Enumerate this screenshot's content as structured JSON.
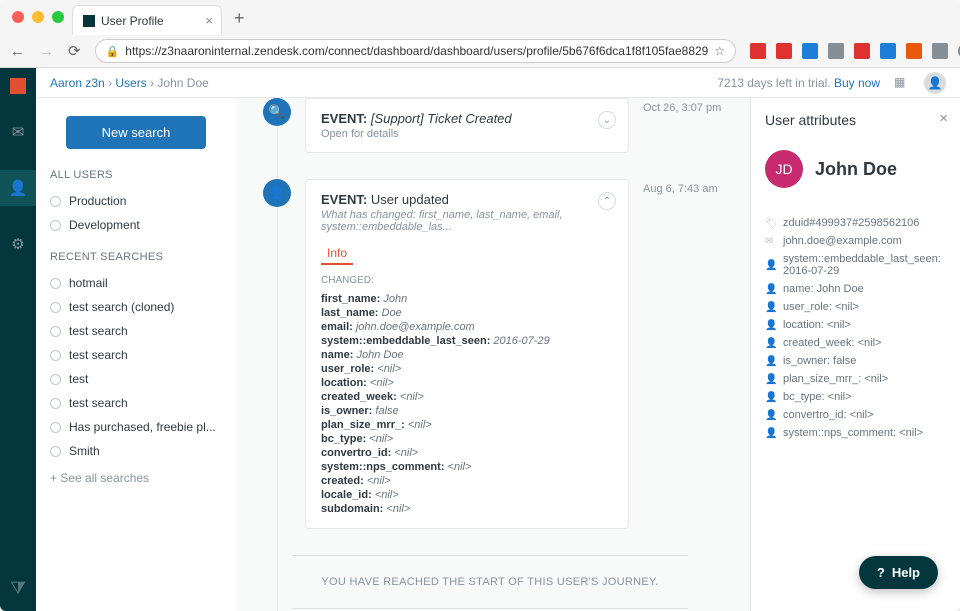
{
  "browser": {
    "tab_title": "User Profile",
    "url": "https://z3naaroninternal.zendesk.com/connect/dashboard/dashboard/users/profile/5b676f6dca1f8f105fae8829"
  },
  "breadcrumb": {
    "root": "Aaron z3n",
    "mid": "Users",
    "current": "John Doe"
  },
  "trial": {
    "text": "7213 days left in trial.",
    "link": "Buy now"
  },
  "sidebar": {
    "new_search": "New search",
    "all_users_heading": "ALL USERS",
    "all_users": [
      "Production",
      "Development"
    ],
    "recent_heading": "RECENT SEARCHES",
    "recent": [
      "hotmail",
      "test search (cloned)",
      "test search",
      "test search",
      "test",
      "test search",
      "Has purchased, freebie pl...",
      "Smith"
    ],
    "see_all": "+ See all searches"
  },
  "events": {
    "e1": {
      "label": "EVENT:",
      "title": "[Support] Ticket Created",
      "sub": "Open for details",
      "time": "Oct 26, 3:07 pm"
    },
    "e2": {
      "label": "EVENT:",
      "title": "User updated",
      "sub": "What has changed: first_name, last_name, email, system::embeddable_las...",
      "time": "Aug 6, 7:43 am",
      "info_tab": "Info",
      "changed_heading": "CHANGED:",
      "attrs": [
        {
          "k": "first_name:",
          "v": "John"
        },
        {
          "k": "last_name:",
          "v": "Doe"
        },
        {
          "k": "email:",
          "v": "john.doe@example.com"
        },
        {
          "k": "system::embeddable_last_seen:",
          "v": "2016-07-29"
        },
        {
          "k": "name:",
          "v": "John Doe"
        },
        {
          "k": "user_role:",
          "v": "<nil>"
        },
        {
          "k": "location:",
          "v": "<nil>"
        },
        {
          "k": "created_week:",
          "v": "<nil>"
        },
        {
          "k": "is_owner:",
          "v": "false"
        },
        {
          "k": "plan_size_mrr_:",
          "v": "<nil>"
        },
        {
          "k": "bc_type:",
          "v": "<nil>"
        },
        {
          "k": "convertro_id:",
          "v": "<nil>"
        },
        {
          "k": "system::nps_comment:",
          "v": "<nil>"
        },
        {
          "k": "created:",
          "v": "<nil>"
        },
        {
          "k": "locale_id:",
          "v": "<nil>"
        },
        {
          "k": "subdomain:",
          "v": "<nil>"
        }
      ]
    },
    "journey_end": "YOU HAVE REACHED THE START OF THIS USER'S JOURNEY."
  },
  "panel": {
    "heading": "User attributes",
    "initials": "JD",
    "name": "John Doe",
    "attrs": [
      "zduid#499937#2598562106",
      "john.doe@example.com",
      "system::embeddable_last_seen: 2016-07-29",
      "name: John Doe",
      "user_role: <nil>",
      "location: <nil>",
      "created_week: <nil>",
      "is_owner: false",
      "plan_size_mrr_: <nil>",
      "bc_type: <nil>",
      "convertro_id: <nil>",
      "system::nps_comment: <nil>"
    ]
  },
  "help": "Help"
}
